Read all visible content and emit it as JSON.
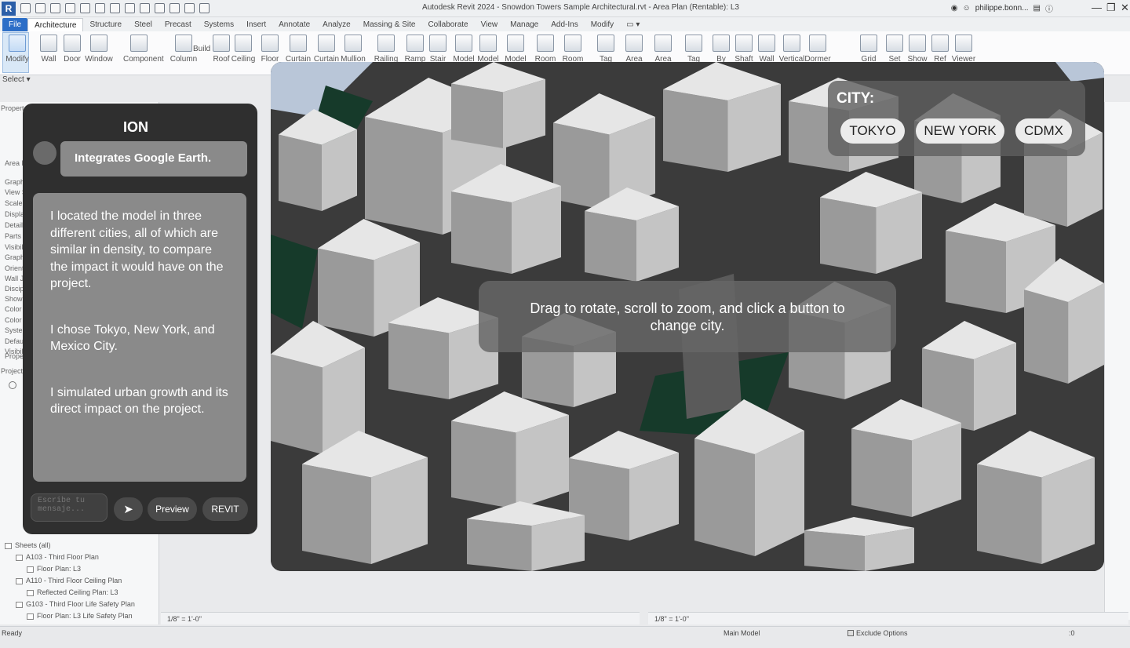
{
  "window": {
    "title": "Autodesk Revit 2024 - Snowdon Towers Sample Architectural.rvt - Area Plan (Rentable): L3",
    "user": "philippe.bonn...",
    "app_logo": "R"
  },
  "ribbon": {
    "tabs": [
      "File",
      "Architecture",
      "Structure",
      "Steel",
      "Precast",
      "Systems",
      "Insert",
      "Annotate",
      "Analyze",
      "Massing & Site",
      "Collaborate",
      "View",
      "Manage",
      "Add-Ins",
      "Modify"
    ],
    "active_tab": "Architecture",
    "buttons": [
      "Modify",
      "Wall",
      "Door",
      "Window",
      "Component",
      "Column",
      "Roof",
      "Ceiling",
      "Floor",
      "Curtain",
      "Curtain",
      "Mullion",
      "Railing",
      "Ramp",
      "Stair",
      "Model",
      "Model",
      "Model",
      "Room",
      "Room",
      "Tag",
      "Area",
      "Area",
      "Tag",
      "By",
      "Shaft",
      "Wall",
      "Vertical",
      "Dormer",
      "Grid",
      "Set",
      "Show",
      "Ref",
      "Viewer"
    ],
    "panel_label": "Build",
    "select_label": "Select"
  },
  "properties_panel": {
    "labels": [
      "Propert",
      "Area P",
      "Graphi",
      "View S",
      "Scale",
      "Displa",
      "Detail",
      "Parts",
      "Visibil",
      "Graph",
      "Orient",
      "Wall J",
      "Discip",
      "Show",
      "Color",
      "Color",
      "System",
      "Defau",
      "Visibil",
      "Propert",
      "Project"
    ]
  },
  "project_browser": {
    "rows": [
      {
        "text": "Sheets (all)",
        "indent": 1
      },
      {
        "text": "A103 - Third Floor Plan",
        "indent": 2
      },
      {
        "text": "Floor Plan: L3",
        "indent": 3
      },
      {
        "text": "A110 - Third Floor Ceiling Plan",
        "indent": 2
      },
      {
        "text": "Reflected Ceiling Plan: L3",
        "indent": 3
      },
      {
        "text": "G103 - Third Floor Life Safety Plan",
        "indent": 2
      },
      {
        "text": "Floor Plan: L3 Life Safety Plan",
        "indent": 3
      }
    ]
  },
  "ion_chat": {
    "title": "ION",
    "bubble": "Integrates Google Earth.",
    "message_paragraphs": [
      "I located the model in three different cities, all of which are similar in density, to compare the impact it would have on the project.",
      "I chose Tokyo, New York, and Mexico City.",
      "I simulated urban growth and its direct impact on the project."
    ],
    "input_placeholder": "Escribe tu mensaje...",
    "send_icon": "➤",
    "preview_label": "Preview",
    "revit_label": "REVIT"
  },
  "viewer": {
    "city_title": "CITY:",
    "city_buttons": [
      "TOKYO",
      "NEW YORK",
      "CDMX"
    ],
    "hint": "Drag to rotate, scroll to zoom, and click a button to change city."
  },
  "view_control": {
    "scale_left": "1/8\" = 1'-0\"",
    "scale_right": "1/8\" = 1'-0\""
  },
  "statusbar": {
    "ready": "Ready",
    "model": "Main Model",
    "exclude": "Exclude Options",
    "filter_count": ":0"
  }
}
